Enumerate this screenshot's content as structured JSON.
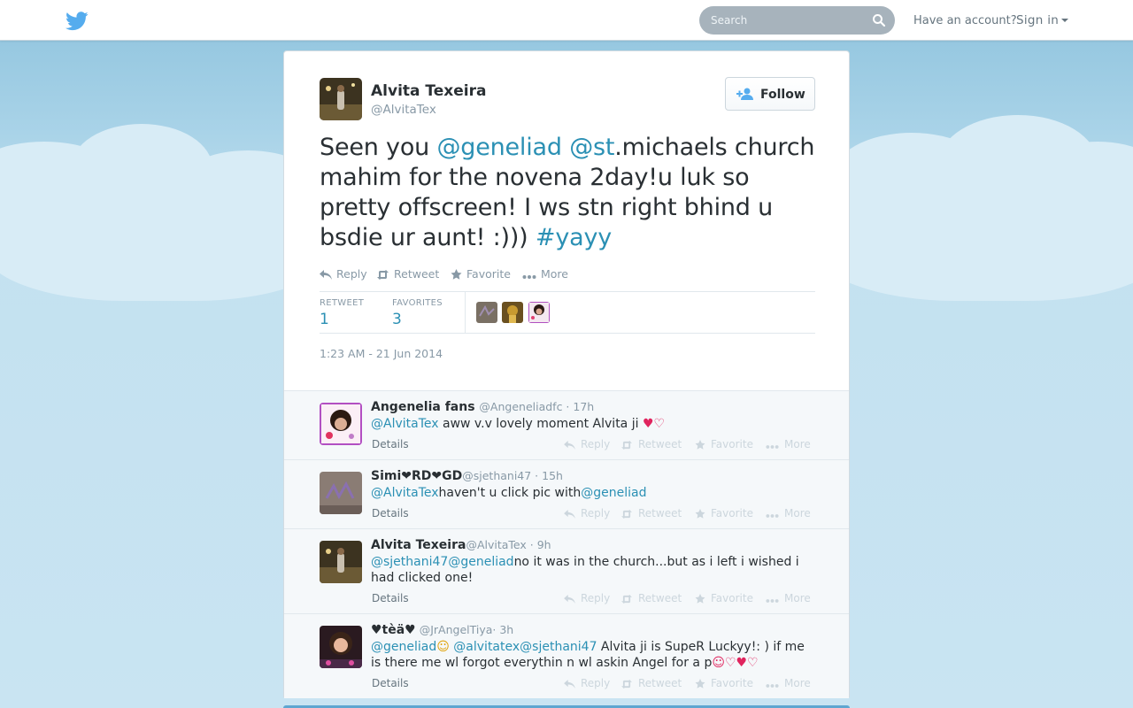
{
  "search": {
    "placeholder": "Search"
  },
  "header": {
    "have_account": "Have an account?",
    "sign_in": "Sign in"
  },
  "tweet": {
    "fullname": "Alvita Texeira",
    "username": "@AlvitaTex",
    "follow_label": "Follow",
    "text_parts": {
      "p1": "Seen you ",
      "mention1": "@geneliad",
      "p2": " ",
      "mention2": "@st",
      "p3": ".michaels church mahim for the novena 2day!u luk so pretty offscreen! I ws stn right bhind u bsdie ur aunt! :))) ",
      "hashtag": "#yayy"
    },
    "actions": {
      "reply": "Reply",
      "retweet": "Retweet",
      "favorite": "Favorite",
      "more": "More"
    },
    "stats": {
      "retweet_label": "RETWEET",
      "retweet_count": "1",
      "favorites_label": "FAVORITES",
      "favorites_count": "3"
    },
    "timestamp": "1:23 AM - 21 Jun 2014"
  },
  "replies": [
    {
      "name": "Angenelia fans",
      "handle": "@Angeneliadfc · 17h",
      "mention": "@AlvitaTex",
      "text": " aww v.v lovely moment Alvita ji ",
      "emoji": "♥♡",
      "details": "Details"
    },
    {
      "name": "Simi❤RD❤GD",
      "handle": "@sjethani47 · 15h",
      "mention": "@AlvitaTex",
      "text": "haven't u click pic with",
      "mention2": "@geneliad",
      "details": "Details"
    },
    {
      "name": "Alvita Texeira",
      "handle": "@AlvitaTex · 9h",
      "mention": "@sjethani47",
      "mention2": "@geneliad",
      "text": "no it was in the church...but as i left i wished i had clicked one!",
      "details": "Details"
    },
    {
      "name": "♥tèä♥",
      "handle": " @JrAngelTiya· 3h",
      "mention": "@geneliad",
      "emoji1": "☺",
      "mention2": "@alvitatex",
      "mention3": "@sjethani47",
      "text": " Alvita ji is SupeR Luckyy!: ) if me is there me wl forgot everythin n wl askin Angel for a p",
      "emoji2": "☺♡♥♡",
      "details": "Details"
    }
  ],
  "reply_actions": {
    "reply": "Reply",
    "retweet": "Retweet",
    "favorite": "Favorite",
    "more": "More"
  },
  "colors": {
    "link": "#2b90b4",
    "brand": "#55acee",
    "text": "#292f33",
    "muted": "#8899a6"
  }
}
